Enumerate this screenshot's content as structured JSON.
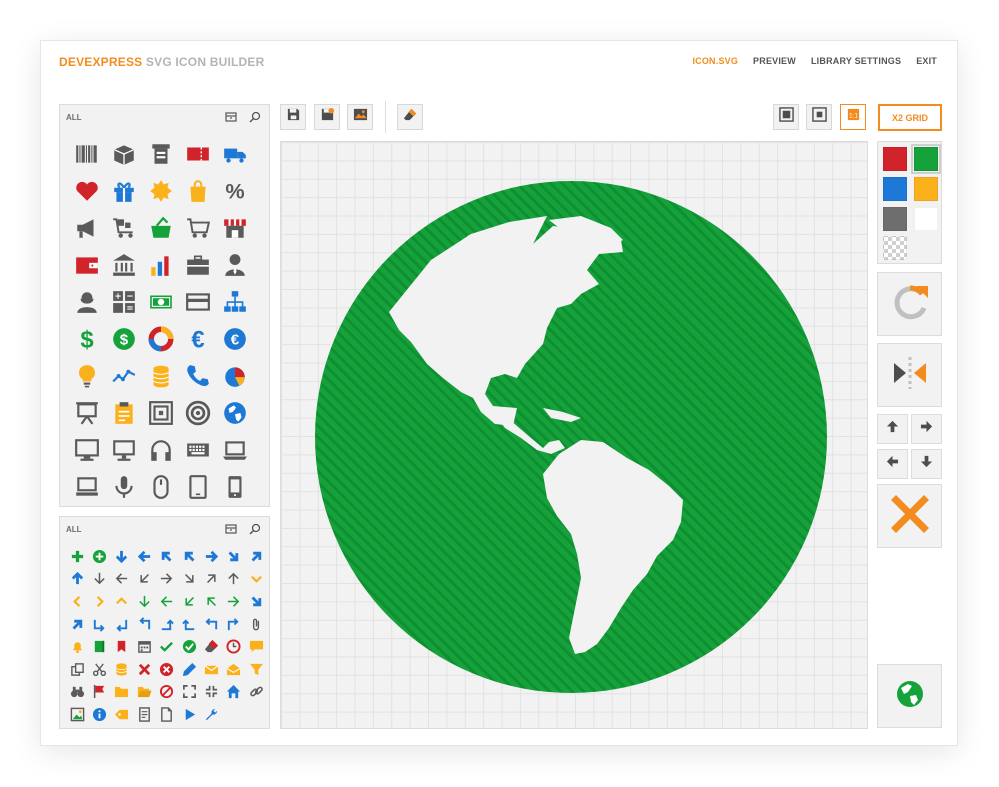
{
  "app": {
    "brand": "DEVEXPRESS",
    "title_rest": "SVG ICON BUILDER"
  },
  "nav": [
    {
      "label": "ICON.SVG",
      "active": true
    },
    {
      "label": "PREVIEW",
      "active": false
    },
    {
      "label": "LIBRARY SETTINGS",
      "active": false
    },
    {
      "label": "EXIT",
      "active": false
    }
  ],
  "library_panel": {
    "filter_label": "ALL",
    "icons": [
      "barcode-icon",
      "box-icon",
      "cash-register-icon",
      "ticket-icon",
      "truck-icon",
      "heart-icon",
      "gift-icon",
      "badge-icon",
      "shopping-bag-icon",
      "percent-icon",
      "megaphone-icon",
      "cart-boxes-icon",
      "basket-icon",
      "shopping-cart-icon",
      "store-icon",
      "wallet-icon",
      "bank-icon",
      "bar-chart-icon",
      "briefcase-icon",
      "businessman-icon",
      "businesswoman-icon",
      "calculator-icon",
      "banknote-icon",
      "credit-card-icon",
      "org-chart-icon",
      "dollar-icon",
      "dollar-circle-icon",
      "lifebuoy-icon",
      "euro-icon",
      "euro-circle-icon",
      "lightbulb-icon",
      "line-chart-icon",
      "coins-icon",
      "phone-icon",
      "pie-chart-icon",
      "presentation-icon",
      "clipboard-icon",
      "safe-icon",
      "target-icon",
      "globe-icon",
      "monitor-icon",
      "display-icon",
      "headphones-icon",
      "keyboard-icon",
      "laptop-icon",
      "notebook-icon",
      "microphone-icon",
      "mouse-icon",
      "tablet-icon",
      "smartphone-icon"
    ]
  },
  "actions_panel": {
    "filter_label": "ALL",
    "icons": [
      "plus-icon",
      "plus-circle-icon",
      "arrow-down-icon",
      "arrow-left-icon",
      "arrow-up-left-icon",
      "arrow-up-left-icon",
      "arrow-right-icon",
      "arrow-down-right-icon",
      "arrow-up-right-icon",
      "arrow-up-icon",
      "arrow-down-thin-icon",
      "arrow-left-thin-icon",
      "arrow-down-left-thin-icon",
      "arrow-right-thin-icon",
      "arrow-down-right-thin-icon",
      "arrow-up-right-thin-icon",
      "arrow-up-thin-icon",
      "chevron-down-icon",
      "chevron-left-icon",
      "chevron-right-icon",
      "chevron-up-icon",
      "arrow-down-green-icon",
      "arrow-left-green-icon",
      "arrow-down-left-green-icon",
      "arrow-up-left-green-icon",
      "arrow-right-green-icon",
      "arrow-down-right-icon",
      "arrow-up-right-icon",
      "turn-down-right-icon",
      "turn-down-left-icon",
      "turn-up-left-icon",
      "turn-up-icon",
      "turn-up-right-icon",
      "turn-left-up-icon",
      "turn-right-icon",
      "paperclip-icon",
      "bell-icon",
      "book-icon",
      "bookmark-icon",
      "calendar-icon",
      "check-icon",
      "check-circle-icon",
      "eraser-icon",
      "clock-icon",
      "comment-icon",
      "copy-icon",
      "scissors-icon",
      "database-icon",
      "close-icon",
      "close-circle-icon",
      "pencil-icon",
      "mail-icon",
      "open-mail-icon",
      "filter-icon",
      "binoculars-icon",
      "flag-icon",
      "folder-icon",
      "open-folder-icon",
      "forbidden-icon",
      "fullscreen-icon",
      "collapse-icon",
      "home-icon",
      "link-icon",
      "image-icon",
      "info-icon",
      "tag-icon",
      "document-list-icon",
      "document-icon",
      "play-icon",
      "wrench-icon"
    ]
  },
  "toolbar": [
    "save-icon",
    "save-as-icon",
    "image-icon",
    "eraser-icon"
  ],
  "view_buttons": [
    "view-small-icon",
    "view-medium-icon",
    "view-actual-size-icon"
  ],
  "grid_toggle_label": "X2 GRID",
  "palette": [
    {
      "name": "red",
      "color": "#d0232a"
    },
    {
      "name": "green",
      "color": "#15a23b",
      "selected": true
    },
    {
      "name": "blue",
      "color": "#1d78d6"
    },
    {
      "name": "yellow",
      "color": "#fbb11c"
    },
    {
      "name": "gray",
      "color": "#6e6e6e"
    },
    {
      "name": "white",
      "color": "#ffffff"
    },
    {
      "name": "transparent",
      "color": "transparent"
    }
  ],
  "side_tools": [
    "rotate-icon",
    "flip-horizontal-icon",
    "move-up-icon",
    "move-right-icon",
    "move-left-icon",
    "move-down-icon",
    "delete-icon",
    "preview-globe-icon"
  ],
  "canvas": {
    "icon": "globe-icon",
    "fill": "#15a23b",
    "hatch": "#0f8e32"
  }
}
